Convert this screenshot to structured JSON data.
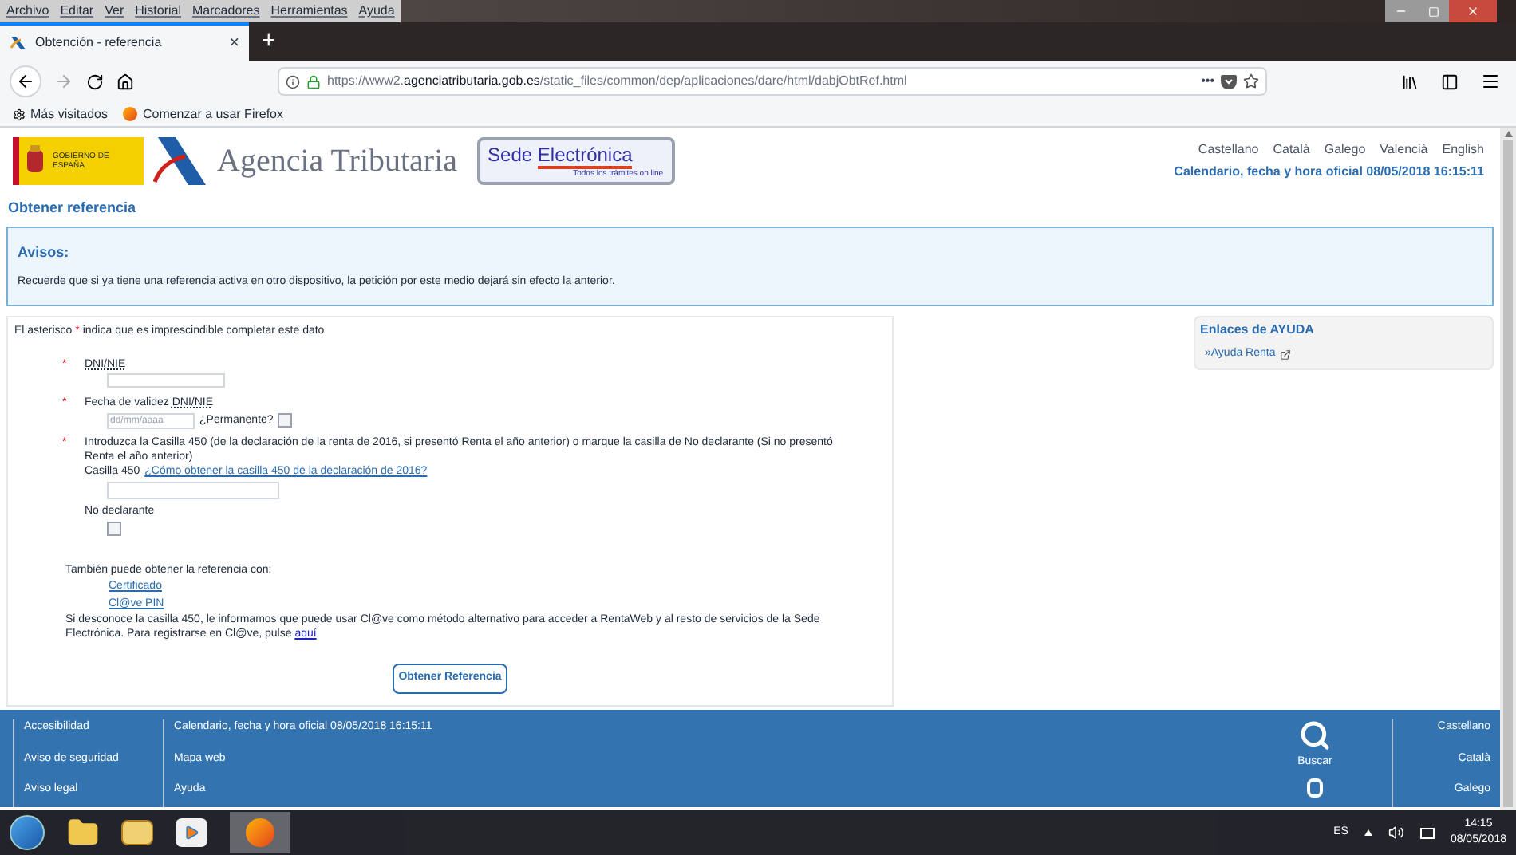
{
  "menu_bar": [
    "Archivo",
    "Editar",
    "Ver",
    "Historial",
    "Marcadores",
    "Herramientas",
    "Ayuda"
  ],
  "tab": {
    "title": "Obtención - referencia",
    "close": "×",
    "selected": true
  },
  "new_tab": "+",
  "address_bar": {
    "url_prefix": "https://www2.",
    "url_domain": "agenciatributaria.gob.es",
    "url_path": "/static_files/common/dep/aplicaciones/dare/html/dabjObtRef.html",
    "page_actions": "•••"
  },
  "bookmarks": [
    "Más visitados",
    "Comenzar a usar Firefox"
  ],
  "header": {
    "gov_logo_text": "GOBIERNO DE ESPAÑA",
    "agency_name": "Agencia Tributaria",
    "sede_word_1": "Sede",
    "sede_word_2": "Electrónica",
    "sede_subtitle": "Todos los trámites on line",
    "languages": [
      "Castellano",
      "Català",
      "Galego",
      "Valencià",
      "English"
    ],
    "calendar_link": "Calendario, fecha y hora oficial 08/05/2018 16:15:11"
  },
  "page_title": "Obtener referencia",
  "notice": {
    "title": "Avisos:",
    "text": "Recuerde que si ya tiene una referencia activa en otro dispositivo, la petición por este medio dejará sin efecto la anterior."
  },
  "form": {
    "note_before": "El asterisco",
    "asterisk": "*",
    "note_after": "indica que es imprescindible completar este dato",
    "dni": {
      "label": "DNI/NIE",
      "required": true
    },
    "validity": {
      "label": "Fecha de validez",
      "abbr": "DNI/NIE",
      "required": true,
      "placeholder": "dd/mm/aaaa",
      "permanent_label": "¿Permanente?",
      "permanent_checked": false
    },
    "casilla": {
      "required": true,
      "text": "Introduzca la Casilla 450 (de la declaración de la renta de 2016, si presentó Renta el año anterior) o marque la casilla de No declarante (Si no presentó Renta el año anterior)",
      "label": "Casilla 450",
      "help_link": "¿Cómo obtener la casilla 450 de la declaración de 2016?",
      "no_declarante_label": "No declarante",
      "no_declarante_checked": false
    },
    "alternatives_intro": "También puede obtener la referencia con:",
    "alternatives": [
      "Certificado",
      "Cl@ve PIN"
    ],
    "info_text": "Si desconoce la casilla 450, le informamos que puede usar Cl@ve como método alternativo para acceder a RentaWeb y al resto de servicios de la Sede Electrónica. Para registrarse en Cl@ve, pulse",
    "info_link": "aquí",
    "submit": "Obtener Referencia"
  },
  "help_panel": {
    "title": "Enlaces de AYUDA",
    "links": [
      "»Ayuda Renta"
    ]
  },
  "footer": {
    "column_1": [
      "Accesibilidad",
      "Aviso de seguridad",
      "Aviso legal"
    ],
    "column_2": [
      "Calendario, fecha y hora oficial 08/05/2018 16:15:11",
      "Mapa web",
      "Ayuda"
    ],
    "search": "Buscar",
    "languages": [
      "Castellano",
      "Català",
      "Galego"
    ]
  },
  "taskbar": {
    "language": "ES",
    "time": "14:15",
    "date": "08/05/2018"
  }
}
